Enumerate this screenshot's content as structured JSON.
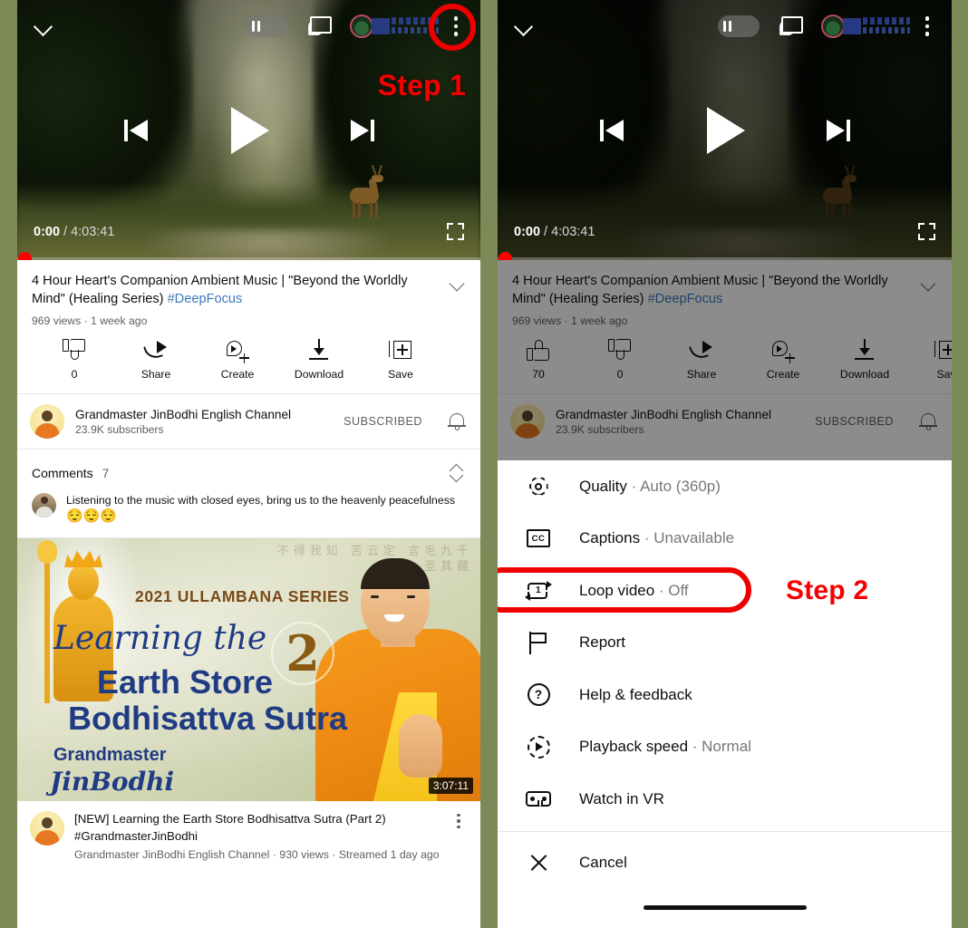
{
  "annotations": {
    "step1": "Step 1",
    "step2": "Step 2",
    "highlight_color": "#ee0000"
  },
  "player": {
    "current_time": "0:00",
    "separator": "/",
    "duration": "4:03:41",
    "collapse_icon": "chevron-down-icon",
    "pause_icon": "pause-icon",
    "cast_icon": "cast-icon",
    "menu_icon": "kebab-menu-icon",
    "prev_icon": "previous-track-icon",
    "play_icon": "play-icon",
    "next_icon": "next-track-icon",
    "fullscreen_icon": "fullscreen-icon"
  },
  "video": {
    "title_part1": "4 Hour Heart's Companion Ambient Music | \"Beyond the Worldly Mind\" (Healing Series) ",
    "title_tag": "#DeepFocus",
    "stats": "969 views · 1 week ago",
    "expand_icon": "chevron-down-icon"
  },
  "actions": [
    {
      "label": "70",
      "icon": "thumb-up-icon"
    },
    {
      "label": "0",
      "icon": "thumb-down-icon"
    },
    {
      "label": "Share",
      "icon": "share-icon"
    },
    {
      "label": "Create",
      "icon": "create-icon"
    },
    {
      "label": "Download",
      "icon": "download-icon"
    },
    {
      "label": "Save",
      "icon": "save-icon"
    },
    {
      "label": "Sav",
      "icon": "save-icon"
    }
  ],
  "channel": {
    "name": "Grandmaster JinBodhi English Channel",
    "subscribers": "23.9K subscribers",
    "subscribe_state": "SUBSCRIBED",
    "bell_icon": "notification-bell-icon",
    "avatar": "channel-avatar"
  },
  "comments": {
    "title": "Comments",
    "count": "7",
    "toggle_icon": "expand-collapse-icon",
    "first": {
      "text": "Listening to the music with closed eyes, bring us to the heavenly peacefulness",
      "emoji": "😌😌😌"
    }
  },
  "suggested": {
    "thumbnail": {
      "series": "2021 ULLAMBANA SERIES",
      "line1": "Learning the",
      "line2": "Earth Store",
      "line3": "Bodhisattva Sutra",
      "number": "2",
      "byline_top": "Grandmaster",
      "byline_bottom": "JinBodhi",
      "cjk_overlay": "不得我知 苦云定 言毛九千 圣其藏",
      "duration": "3:07:11"
    },
    "title": "[NEW] Learning the Earth Store Bodhisattva Sutra (Part 2) #GrandmasterJinBodhi",
    "meta": "Grandmaster JinBodhi English Channel · 930 views · Streamed 1 day ago",
    "kebab_icon": "kebab-menu-icon"
  },
  "sheet": {
    "items": [
      {
        "label": "Quality",
        "value": " · Auto (360p)",
        "icon": "gear-icon"
      },
      {
        "label": "Captions",
        "value": " · Unavailable",
        "icon": "captions-cc-icon"
      },
      {
        "label": "Loop video",
        "value": " · Off",
        "icon": "loop-video-icon"
      },
      {
        "label": "Report",
        "value": "",
        "icon": "flag-icon"
      },
      {
        "label": "Help & feedback",
        "value": "",
        "icon": "help-circle-icon"
      },
      {
        "label": "Playback speed",
        "value": " · Normal",
        "icon": "playback-speed-icon"
      },
      {
        "label": "Watch in VR",
        "value": "",
        "icon": "vr-headset-icon"
      }
    ],
    "cancel": {
      "label": "Cancel",
      "icon": "close-x-icon"
    },
    "cc_glyph": "CC",
    "help_glyph": "?",
    "loop_glyph": "1"
  }
}
